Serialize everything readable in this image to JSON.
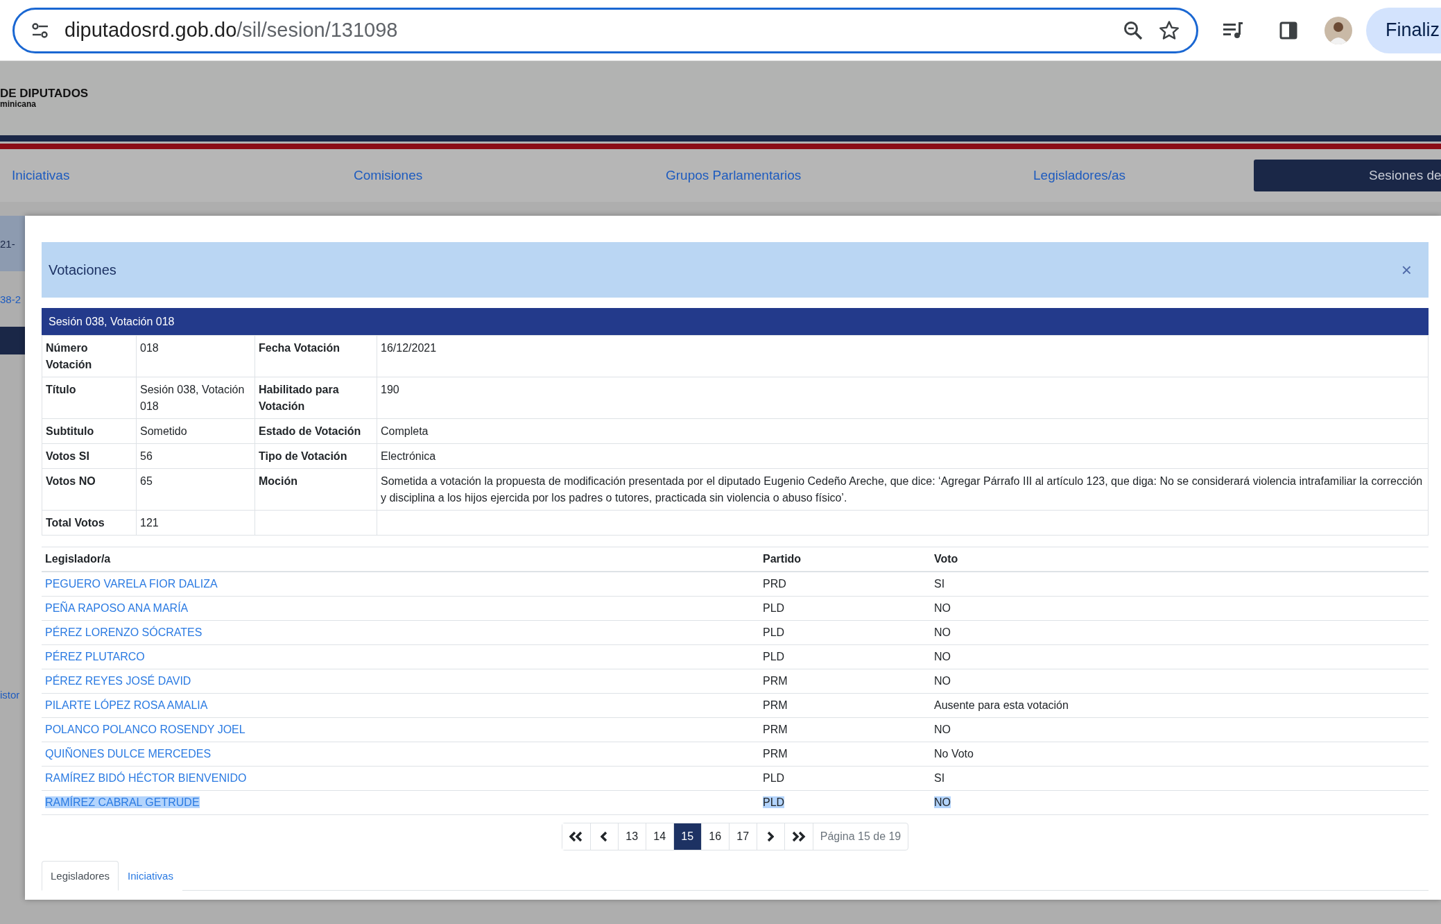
{
  "browser": {
    "url_host": "diputadosrd.gob.do",
    "url_path": "/sil/sesion/131098",
    "action_button": "Finaliz"
  },
  "site": {
    "logo_lines": [
      "DE DIPUTADOS",
      "minicana"
    ],
    "nav": [
      {
        "label": "Iniciativas",
        "selected": false
      },
      {
        "label": "Comisiones",
        "selected": false
      },
      {
        "label": "Grupos Parlamentarios",
        "selected": false
      },
      {
        "label": "Legisladores/as",
        "selected": false
      },
      {
        "label": "Sesiones de",
        "selected": true
      }
    ],
    "background_fragments": [
      "21-",
      "38-2",
      "istor"
    ]
  },
  "modal": {
    "title": "Votaciones",
    "close": "×",
    "session_title": "Sesión 038, Votación 018",
    "info_rows": [
      [
        "Número Votación",
        "018",
        "Fecha Votación",
        "16/12/2021"
      ],
      [
        "Título",
        "Sesión 038, Votación 018",
        "Habilitado para Votación",
        "190"
      ],
      [
        "Subtitulo",
        "Sometido",
        "Estado de Votación",
        "Completa"
      ],
      [
        "Votos SI",
        "56",
        "Tipo de Votación",
        "Electrónica"
      ],
      [
        "Votos NO",
        "65",
        "Moción",
        "Sometida a votación la propuesta de modificación presentada por el diputado Eugenio Cedeño Areche, que dice: ‘Agregar Párrafo III al artículo 123, que diga: No se considerará violencia intrafamiliar la corrección y disciplina a los hijos ejercida por los padres o tutores, practicada sin violencia o abuso físico’."
      ],
      [
        "Total Votos",
        "121"
      ]
    ],
    "legislators": {
      "columns": [
        "Legislador/a",
        "Partido",
        "Voto"
      ],
      "rows": [
        {
          "name": "PEGUERO VARELA FIOR DALIZA",
          "party": "PRD",
          "vote": "SI",
          "selected": false
        },
        {
          "name": "PEÑA RAPOSO ANA MARÍA",
          "party": "PLD",
          "vote": "NO",
          "selected": false
        },
        {
          "name": "PÉREZ LORENZO SÓCRATES",
          "party": "PLD",
          "vote": "NO",
          "selected": false
        },
        {
          "name": "PÉREZ PLUTARCO",
          "party": "PLD",
          "vote": "NO",
          "selected": false
        },
        {
          "name": "PÉREZ REYES JOSÉ DAVID",
          "party": "PRM",
          "vote": "NO",
          "selected": false
        },
        {
          "name": "PILARTE LÓPEZ ROSA AMALIA",
          "party": "PRM",
          "vote": "Ausente para esta votación",
          "selected": false
        },
        {
          "name": "POLANCO POLANCO ROSENDY JOEL",
          "party": "PRM",
          "vote": "NO",
          "selected": false
        },
        {
          "name": "QUIÑONES DULCE MERCEDES",
          "party": "PRM",
          "vote": "No Voto",
          "selected": false
        },
        {
          "name": "RAMÍREZ BIDÓ HÉCTOR BIENVENIDO",
          "party": "PLD",
          "vote": "SI",
          "selected": false
        },
        {
          "name": "RAMÍREZ CABRAL GETRUDE",
          "party": "PLD",
          "vote": "NO",
          "selected": true
        }
      ]
    },
    "pagination": {
      "items": [
        {
          "kind": "first"
        },
        {
          "kind": "prev"
        },
        {
          "kind": "page",
          "label": "13",
          "selected": false
        },
        {
          "kind": "page",
          "label": "14",
          "selected": false
        },
        {
          "kind": "page",
          "label": "15",
          "selected": true
        },
        {
          "kind": "page",
          "label": "16",
          "selected": false
        },
        {
          "kind": "page",
          "label": "17",
          "selected": false
        },
        {
          "kind": "next"
        },
        {
          "kind": "last"
        }
      ],
      "info": "Página 15 de 19"
    },
    "tabs": [
      {
        "label": "Legisladores",
        "selected": true
      },
      {
        "label": "Iniciativas",
        "selected": false
      }
    ]
  }
}
